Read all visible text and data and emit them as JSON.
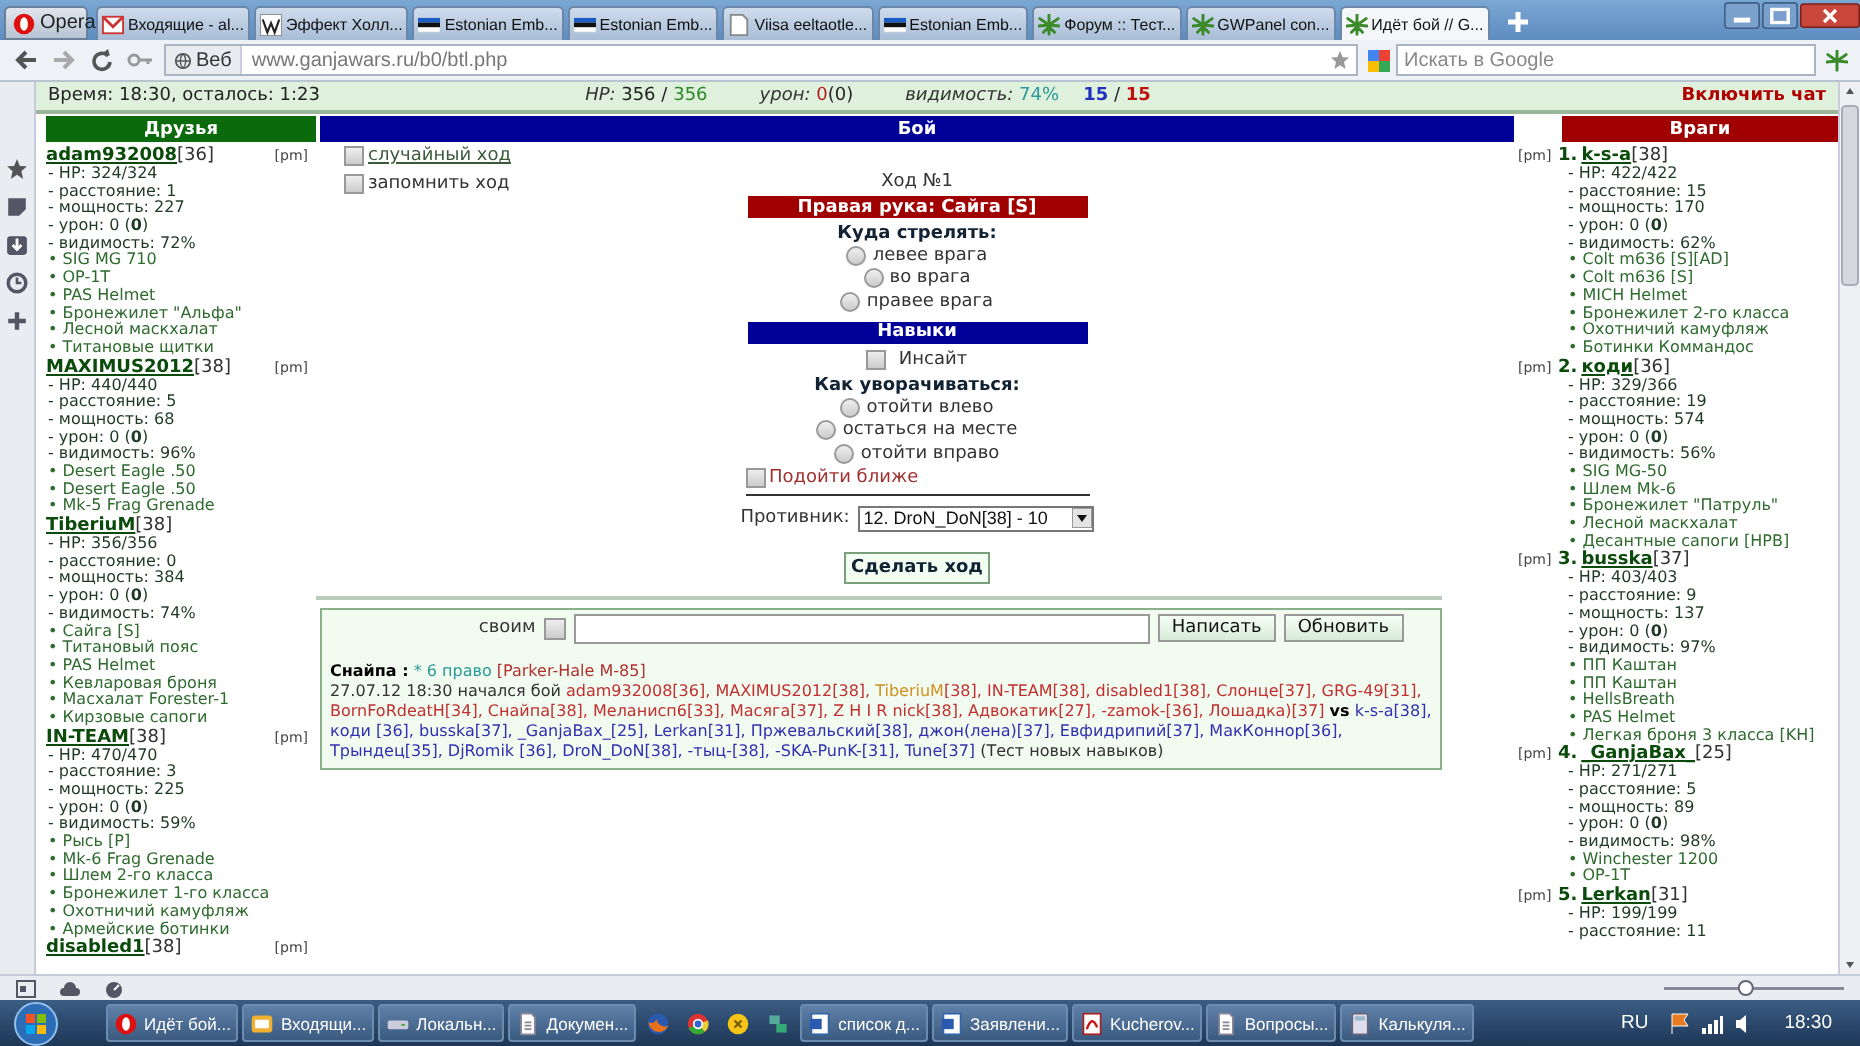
{
  "browser": {
    "menu_button": "Opera",
    "tabs": [
      {
        "label": "Входящие - al...",
        "kind": "mail",
        "selected": false
      },
      {
        "label": "Эффект Холл...",
        "kind": "wiki",
        "selected": false
      },
      {
        "label": "Estonian Emb...",
        "kind": "flag",
        "selected": false
      },
      {
        "label": "Estonian Emb...",
        "kind": "flag",
        "selected": false
      },
      {
        "label": "Viisa eeltaotle...",
        "kind": "doc",
        "selected": false
      },
      {
        "label": "Estonian Emb...",
        "kind": "flag",
        "selected": false
      },
      {
        "label": "Форум :: Тест...",
        "kind": "leaf",
        "selected": false
      },
      {
        "label": "GWPanel con...",
        "kind": "leaf",
        "selected": false
      },
      {
        "label": "Идёт бой // G...",
        "kind": "leaf",
        "selected": true
      }
    ],
    "address": {
      "badge": "Веб",
      "url": "www.ganjawars.ru/b0/btl.php"
    },
    "search": {
      "placeholder": "Искать в Google"
    }
  },
  "info": {
    "time": "Время: 18:30, осталось:  1:23",
    "hp_label": "HP:",
    "hp_current": "356",
    "hp_separator": "/",
    "hp_max": "356",
    "damage_label": "урон:",
    "damage": "0",
    "damage_extra": "(0)",
    "visibility_label": "видимость:",
    "visibility": "74%",
    "friends_count": "15",
    "count_separator": "/",
    "enemies_count": "15",
    "chat_link": "Включить чат"
  },
  "friends": {
    "title": "Друзья",
    "players": [
      {
        "name": "adam932008",
        "level": "[36]",
        "pm": "[pm]",
        "lines": [
          {
            "kind": "stat",
            "text": "- HP: 324/324"
          },
          {
            "kind": "stat",
            "text": "- расстояние: 1"
          },
          {
            "kind": "stat",
            "text": "- мощность: 227"
          },
          {
            "kind": "stat",
            "text": "- урон: 0 (**0**)"
          },
          {
            "kind": "stat",
            "text": "- видимость: 72%"
          },
          {
            "kind": "item",
            "text": "• SIG MG 710"
          },
          {
            "kind": "item",
            "text": "• OP-1T"
          },
          {
            "kind": "item",
            "text": "• PAS Helmet"
          },
          {
            "kind": "item",
            "text": "• Бронежилет \"Альфа\""
          },
          {
            "kind": "item",
            "text": "• Лесной маскхалат"
          },
          {
            "kind": "item",
            "text": "• Титановые щитки"
          }
        ]
      },
      {
        "name": "MAXIMUS2012",
        "level": "[38]",
        "pm": "[pm]",
        "lines": [
          {
            "kind": "stat",
            "text": "- HP: 440/440"
          },
          {
            "kind": "stat",
            "text": "- расстояние: 5"
          },
          {
            "kind": "stat",
            "text": "- мощность: 68"
          },
          {
            "kind": "stat",
            "text": "- урон: 0 (**0**)"
          },
          {
            "kind": "stat",
            "text": "- видимость: 96%"
          },
          {
            "kind": "item",
            "text": "• Desert Eagle .50"
          },
          {
            "kind": "item",
            "text": "• Desert Eagle .50"
          },
          {
            "kind": "item",
            "text": "• Mk-5 Frag Grenade"
          }
        ]
      },
      {
        "name": "TiberiuM",
        "level": "[38]",
        "lines": [
          {
            "kind": "stat",
            "text": "- HP: 356/356"
          },
          {
            "kind": "stat",
            "text": "- расстояние: 0"
          },
          {
            "kind": "stat",
            "text": "- мощность: 384"
          },
          {
            "kind": "stat",
            "text": "- урон: 0 (**0**)"
          },
          {
            "kind": "stat",
            "text": "- видимость: 74%"
          },
          {
            "kind": "item",
            "text": "• Сайга [S]"
          },
          {
            "kind": "item",
            "text": "• Титановый пояс"
          },
          {
            "kind": "item",
            "text": "• PAS Helmet"
          },
          {
            "kind": "item",
            "text": "• Кевларовая броня"
          },
          {
            "kind": "item",
            "text": "• Масхалат Forester-1"
          },
          {
            "kind": "item",
            "text": "• Кирзовые сапоги"
          }
        ]
      },
      {
        "name": "IN-TEAM",
        "level": "[38]",
        "pm": "[pm]",
        "lines": [
          {
            "kind": "stat",
            "text": "- HP: 470/470"
          },
          {
            "kind": "stat",
            "text": "- расстояние: 3"
          },
          {
            "kind": "stat",
            "text": "- мощность: 225"
          },
          {
            "kind": "stat",
            "text": "- урон: 0 (**0**)"
          },
          {
            "kind": "stat",
            "text": "- видимость: 59%"
          },
          {
            "kind": "item",
            "text": "• Рысь [P]"
          },
          {
            "kind": "item",
            "text": "• Mk-6 Frag Grenade"
          },
          {
            "kind": "item",
            "text": "• Шлем 2-го класса"
          },
          {
            "kind": "item",
            "text": "• Бронежилет 1-го класса"
          },
          {
            "kind": "item",
            "text": "• Охотничий камуфляж"
          },
          {
            "kind": "item",
            "text": "• Армейские ботинки"
          }
        ]
      },
      {
        "name": "disabled1",
        "level": "[38]",
        "pm": "[pm]"
      }
    ]
  },
  "battle": {
    "title": "Бой",
    "options": [
      {
        "label": "случайный ход",
        "kind": "link",
        "checked": false
      },
      {
        "label": "запомнить ход",
        "kind": "plain",
        "checked": false
      }
    ],
    "turn": "Ход №1",
    "weapon_bar": "Правая рука: Сайга [S]",
    "shoot_title": "Куда стрелять:",
    "shoot_options": [
      {
        "label": "левее врага",
        "selected": false
      },
      {
        "label": "во врага",
        "selected": false
      },
      {
        "label": "правее врага",
        "selected": false
      }
    ],
    "skills_bar": "Навыки",
    "skills": [
      {
        "label": "Инсайт",
        "checked": false
      }
    ],
    "dodge_title": "Как уворачиваться:",
    "dodge_options": [
      {
        "label": "отойти влево",
        "selected": false
      },
      {
        "label": "остаться на месте",
        "selected": false
      },
      {
        "label": "отойти вправо",
        "selected": false
      }
    ],
    "approach": {
      "label": "Подойти ближе",
      "checked": false
    },
    "opponent_label": "Противник:",
    "opponent_value": "12. DroN_DoN[38] - 10",
    "submit": "Сделать ход"
  },
  "chat": {
    "own_label": "своим",
    "own_checked": false,
    "send": "Написать",
    "refresh": "Обновить",
    "log": [
      {
        "segments": [
          {
            "text": "**Снайпа :** ",
            "color": "#000000"
          },
          {
            "text": "* 6 право  ",
            "color": "#2a9a9a"
          },
          {
            "text": "[Parker-Hale M-85]",
            "color": "#b03030"
          }
        ]
      },
      {
        "segments": [
          {
            "text": "27.07.12 18:30 начался бой ",
            "color": "#333333"
          },
          {
            "text": "adam932008[36], MAXIMUS2012[38], ",
            "color": "#c03030"
          },
          {
            "text": "TiberiuM",
            "color": "#d09020"
          },
          {
            "text": "[38], IN-TEAM[38], disabled1[38], Слонце[37], GRG-49[31], BornFoRdeatH[34], Снайпа[38], Меланисп6[33], Масяга[37], Z H I R nick[38], Адвокатик[27], -zamok-[36], Лошадка)[37] ",
            "color": "#c03030"
          },
          {
            "text": "**vs** ",
            "color": "#000000"
          },
          {
            "text": "k-s-a[38], коди [36], busska[37], _GanjaBax_[25], Lerkan[31], Пржевальский[38], джон(лена)[37], Евфидрипий[37], МакКоннор[36], Трындец[35], DjRomik [36], DroN_DoN[38], -тыц-[38], -SKA-PunK-[31], Tune[37] ",
            "color": "#3030b0"
          },
          {
            "text": "(Тест новых навыков)",
            "color": "#333333"
          }
        ]
      }
    ]
  },
  "enemies": {
    "title": "Враги",
    "players": [
      {
        "number": "1.",
        "name": "k-s-a",
        "level": "[38]",
        "pm": "[pm]",
        "lines": [
          {
            "kind": "stat",
            "text": "- HP: 422/422"
          },
          {
            "kind": "stat",
            "text": "- расстояние: 15"
          },
          {
            "kind": "stat",
            "text": "- мощность: 170"
          },
          {
            "kind": "stat",
            "text": "- урон: 0 (**0**)"
          },
          {
            "kind": "stat",
            "text": "- видимость: 62%"
          },
          {
            "kind": "item",
            "text": "• Colt m636 [S][AD]"
          },
          {
            "kind": "item",
            "text": "• Colt m636 [S]"
          },
          {
            "kind": "item",
            "text": "• MICH Helmet"
          },
          {
            "kind": "item",
            "text": "• Бронежилет 2-го класса"
          },
          {
            "kind": "item",
            "text": "• Охотничий камуфляж"
          },
          {
            "kind": "item",
            "text": "• Ботинки Коммандос"
          }
        ]
      },
      {
        "number": "2.",
        "name": "коди",
        "level": "[36]",
        "pm": "[pm]",
        "lines": [
          {
            "kind": "stat",
            "text": "- HP: 329/366"
          },
          {
            "kind": "stat",
            "text": "- расстояние: 19"
          },
          {
            "kind": "stat",
            "text": "- мощность: 574"
          },
          {
            "kind": "stat",
            "text": "- урон: 0 (**0**)"
          },
          {
            "kind": "stat",
            "text": "- видимость: 56%"
          },
          {
            "kind": "item",
            "text": "• SIG MG-50"
          },
          {
            "kind": "item",
            "text": "• Шлем Mk-6"
          },
          {
            "kind": "item",
            "text": "• Бронежилет \"Патруль\""
          },
          {
            "kind": "item",
            "text": "• Лесной маскхалат"
          },
          {
            "kind": "item",
            "text": "• Десантные сапоги [HPB]"
          }
        ]
      },
      {
        "number": "3.",
        "name": "busska",
        "level": "[37]",
        "pm": "[pm]",
        "lines": [
          {
            "kind": "stat",
            "text": "- HP: 403/403"
          },
          {
            "kind": "stat",
            "text": "- расстояние: 9"
          },
          {
            "kind": "stat",
            "text": "- мощность: 137"
          },
          {
            "kind": "stat",
            "text": "- урон: 0 (**0**)"
          },
          {
            "kind": "stat",
            "text": "- видимость: 97%"
          },
          {
            "kind": "item",
            "text": "• ПП Каштан"
          },
          {
            "kind": "item",
            "text": "• ПП Каштан"
          },
          {
            "kind": "item",
            "text": "• HellsBreath"
          },
          {
            "kind": "item",
            "text": "• PAS Helmet"
          },
          {
            "kind": "item",
            "text": "• Легкая броня 3 класса [KH]"
          }
        ]
      },
      {
        "number": "4.",
        "name": "_GanjaBax_",
        "level": "[25]",
        "pm": "[pm]",
        "lines": [
          {
            "kind": "stat",
            "text": "- HP: 271/271"
          },
          {
            "kind": "stat",
            "text": "- расстояние: 5"
          },
          {
            "kind": "stat",
            "text": "- мощность: 89"
          },
          {
            "kind": "stat",
            "text": "- урон: 0 (**0**)"
          },
          {
            "kind": "stat",
            "text": "- видимость: 98%"
          },
          {
            "kind": "item",
            "text": "• Winchester 1200"
          },
          {
            "kind": "item",
            "text": "• OP-1T"
          }
        ]
      },
      {
        "number": "5.",
        "name": "Lerkan",
        "level": "[31]",
        "pm": "[pm]",
        "lines": [
          {
            "kind": "stat",
            "text": "- HP: 199/199"
          },
          {
            "kind": "stat",
            "text": "- расстояние: 11"
          }
        ]
      }
    ]
  },
  "taskbar": {
    "items": [
      {
        "label": "Идёт бой...",
        "kind": "opera"
      },
      {
        "label": "Входящи...",
        "kind": "mailapp"
      },
      {
        "label": "Локальн...",
        "kind": "drive"
      },
      {
        "label": "Докумен...",
        "kind": "doc"
      },
      {
        "kind": "firefox"
      },
      {
        "kind": "chrome"
      },
      {
        "kind": "yellow"
      },
      {
        "kind": "network"
      },
      {
        "label": "список д...",
        "kind": "word"
      },
      {
        "label": "Заявлени...",
        "kind": "word"
      },
      {
        "label": "Kucherov...",
        "kind": "pdf"
      },
      {
        "label": "Вопросы...",
        "kind": "doc"
      },
      {
        "label": "Калькуля...",
        "kind": "calc"
      }
    ],
    "language": "RU",
    "clock": "18:30"
  },
  "status_bar": {
    "zoom": {
      "level": 0.45
    }
  }
}
